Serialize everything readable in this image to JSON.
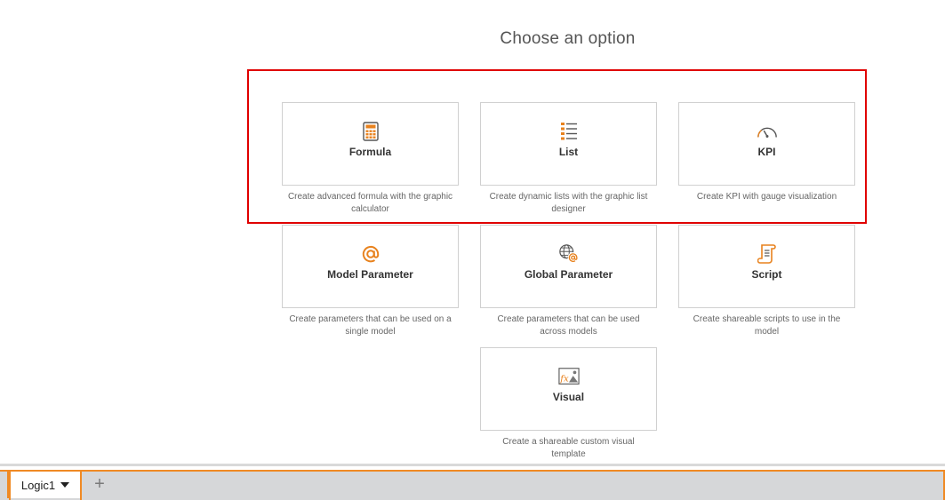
{
  "heading": "Choose an option",
  "options": [
    {
      "id": "formula",
      "label": "Formula",
      "description": "Create advanced formula with the graphic calculator",
      "icon": "calculator-icon"
    },
    {
      "id": "list",
      "label": "List",
      "description": "Create dynamic lists with the graphic list designer",
      "icon": "list-icon"
    },
    {
      "id": "kpi",
      "label": "KPI",
      "description": "Create KPI with gauge visualization",
      "icon": "gauge-icon"
    },
    {
      "id": "model-parameter",
      "label": "Model Parameter",
      "description": "Create parameters that can be used on a single model",
      "icon": "at-sign-icon"
    },
    {
      "id": "global-parameter",
      "label": "Global Parameter",
      "description": "Create parameters that can be used across models",
      "icon": "globe-at-icon"
    },
    {
      "id": "script",
      "label": "Script",
      "description": "Create shareable scripts to use in the model",
      "icon": "script-scroll-icon"
    },
    {
      "id": "visual",
      "label": "Visual",
      "description": "Create a shareable custom visual template",
      "icon": "fx-image-icon"
    }
  ],
  "tabs": {
    "active_label": "Logic1",
    "add_symbol": "+"
  },
  "colors": {
    "accent": "#e8821e",
    "highlight": "#e00000",
    "tab_border": "#f08a24"
  }
}
